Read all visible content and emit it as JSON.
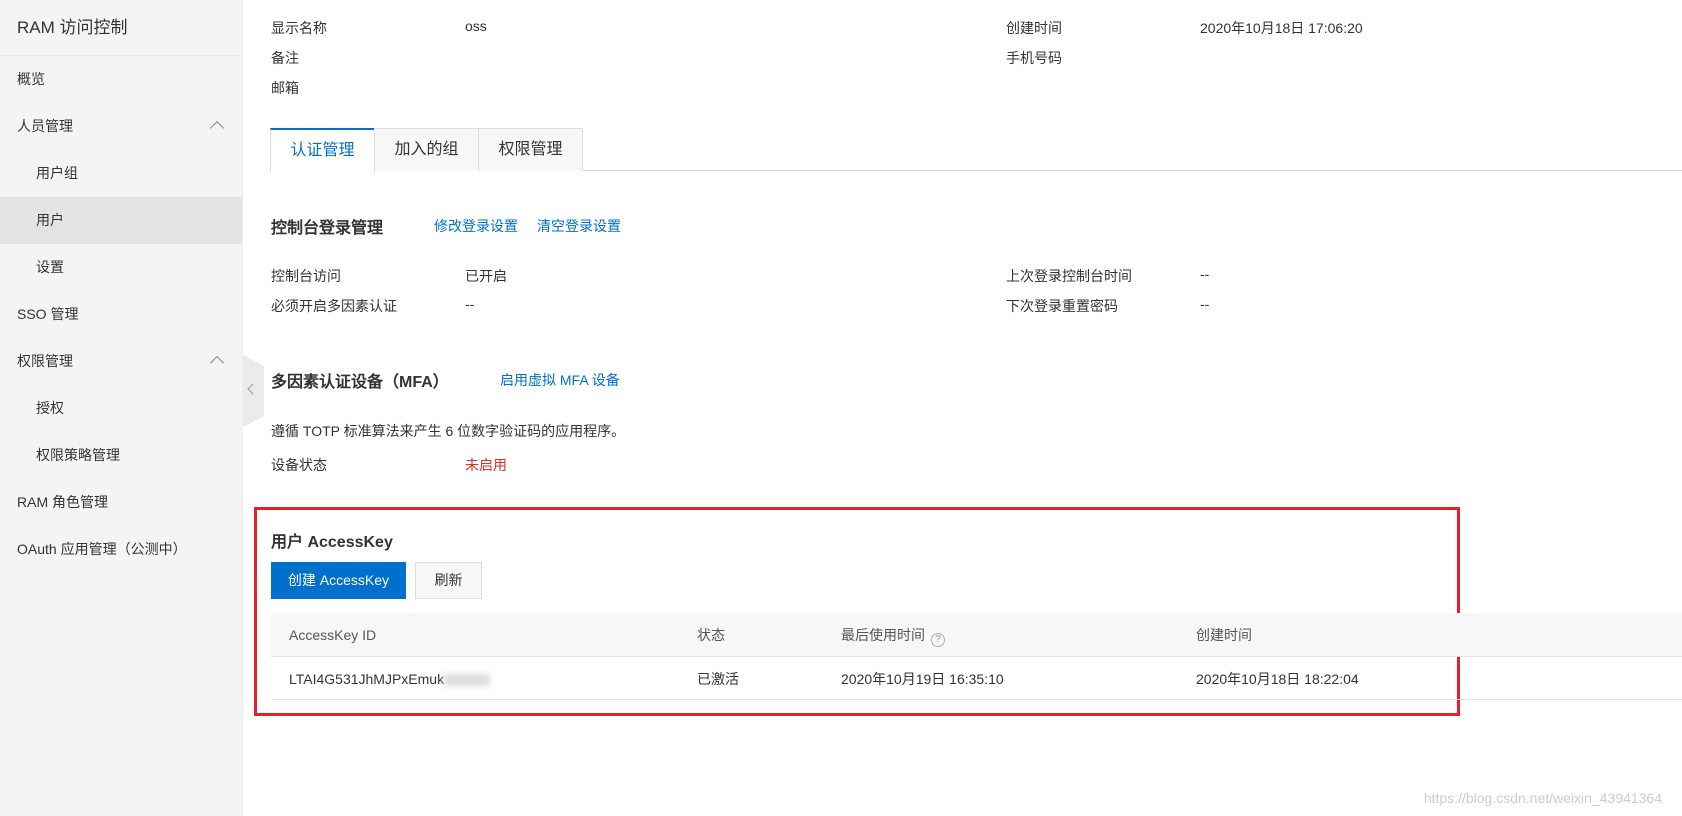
{
  "sidebar": {
    "title": "RAM 访问控制",
    "items": [
      {
        "label": "概览"
      },
      {
        "label": "人员管理"
      },
      {
        "label": "用户组"
      },
      {
        "label": "用户"
      },
      {
        "label": "设置"
      },
      {
        "label": "SSO 管理"
      },
      {
        "label": "权限管理"
      },
      {
        "label": "授权"
      },
      {
        "label": "权限策略管理"
      },
      {
        "label": "RAM 角色管理"
      },
      {
        "label": "OAuth 应用管理（公测中）"
      }
    ]
  },
  "info": {
    "display_name_label": "显示名称",
    "display_name": "oss",
    "remark_label": "备注",
    "email_label": "邮箱",
    "created_label": "创建时间",
    "created": "2020年10月18日 17:06:20",
    "phone_label": "手机号码"
  },
  "tabs": [
    "认证管理",
    "加入的组",
    "权限管理"
  ],
  "console": {
    "title": "控制台登录管理",
    "edit_link": "修改登录设置",
    "clear_link": "清空登录设置",
    "access_label": "控制台访问",
    "access_value": "已开启",
    "mfa_required_label": "必须开启多因素认证",
    "mfa_required_value": "--",
    "last_login_label": "上次登录控制台时间",
    "last_login_value": "--",
    "reset_pwd_label": "下次登录重置密码",
    "reset_pwd_value": "--"
  },
  "mfa": {
    "title": "多因素认证设备（MFA）",
    "enable_link": "启用虚拟 MFA 设备",
    "desc": "遵循 TOTP 标准算法来产生 6 位数字验证码的应用程序。",
    "status_label": "设备状态",
    "status_value": "未启用",
    "status_color": "#d93026"
  },
  "accesskey": {
    "title": "用户 AccessKey",
    "create_button": "创建 AccessKey",
    "refresh_button": "刷新",
    "columns": [
      "AccessKey ID",
      "状态",
      "最后使用时间",
      "创建时间"
    ],
    "rows": [
      {
        "id": "LTAI4G531JhMJPxEmuk",
        "status": "已激活",
        "last_used": "2020年10月19日 16:35:10",
        "created": "2020年10月18日 18:22:04"
      }
    ]
  },
  "watermark": "https://blog.csdn.net/weixin_43941364"
}
